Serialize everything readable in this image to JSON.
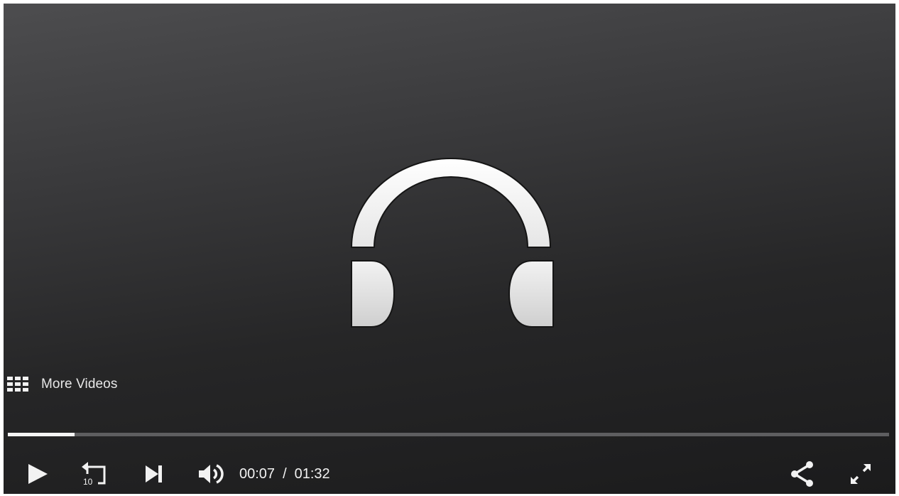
{
  "player": {
    "more_videos_label": "More Videos",
    "current_time": "00:07",
    "time_separator": "/",
    "duration": "01:32",
    "progress_fraction": 0.076,
    "skip_back_seconds": "10",
    "media_type_icon": "headphones-icon"
  },
  "controls": {
    "icons": [
      "play-icon",
      "replay-10-icon",
      "skip-next-icon",
      "volume-icon",
      "share-icon",
      "fullscreen-icon"
    ]
  },
  "colors": {
    "background_top": "#4d4d4f",
    "background_bottom": "#1b1b1c",
    "progress_fill": "#f4f4f4",
    "progress_track": "#5e5e60",
    "icon": "#f2f2f2"
  }
}
